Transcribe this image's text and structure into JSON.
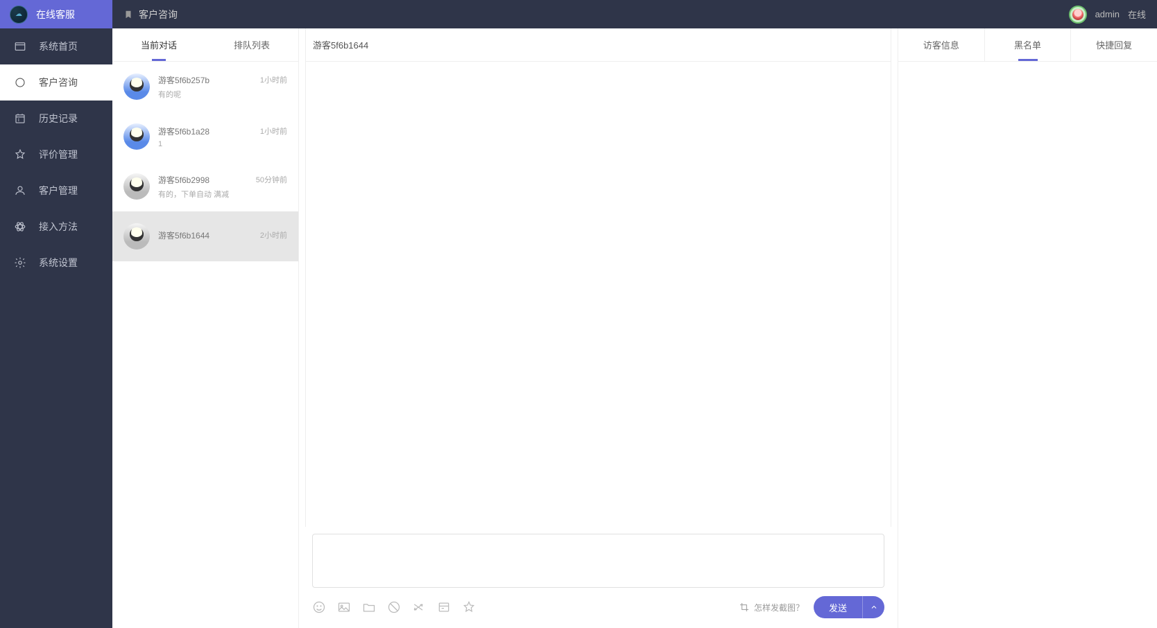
{
  "brand": {
    "name": "在线客服"
  },
  "nav": [
    {
      "label": "系统首页",
      "icon": "window"
    },
    {
      "label": "客户咨询",
      "icon": "circle",
      "active": true
    },
    {
      "label": "历史记录",
      "icon": "calendar"
    },
    {
      "label": "评价管理",
      "icon": "star"
    },
    {
      "label": "客户管理",
      "icon": "user"
    },
    {
      "label": "接入方法",
      "icon": "atom"
    },
    {
      "label": "系统设置",
      "icon": "gear"
    }
  ],
  "topbar": {
    "title": "客户咨询",
    "user_name": "admin",
    "status": "在线"
  },
  "convo_tabs": [
    {
      "label": "当前对话",
      "active": true
    },
    {
      "label": "排队列表"
    }
  ],
  "conversations": [
    {
      "name": "游客5f6b257b",
      "time": "1小时前",
      "preview": "有的呢",
      "avatar": "blue"
    },
    {
      "name": "游客5f6b1a28",
      "time": "1小时前",
      "preview": "1",
      "avatar": "blue"
    },
    {
      "name": "游客5f6b2998",
      "time": "50分钟前",
      "preview": "有的，下单自动 满减",
      "avatar": "gray"
    },
    {
      "name": "游客5f6b1644",
      "time": "2小时前",
      "preview": "",
      "avatar": "gray",
      "selected": true
    }
  ],
  "chat": {
    "header_title": "游客5f6b1644",
    "screenshot_hint": "怎样发截图？",
    "send_label": "发送"
  },
  "info_tabs": [
    {
      "label": "访客信息"
    },
    {
      "label": "黑名单",
      "active": true
    },
    {
      "label": "快捷回复"
    }
  ]
}
